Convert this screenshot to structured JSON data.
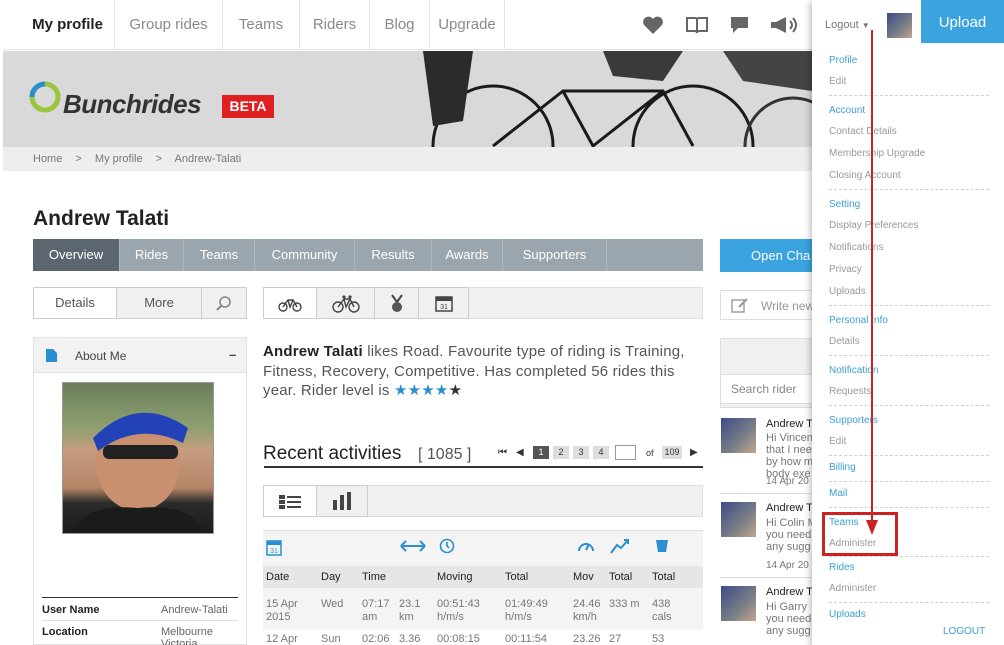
{
  "nav": {
    "items": [
      "My profile",
      "Group rides",
      "Teams",
      "Riders",
      "Blog",
      "Upgrade"
    ],
    "logout_label": "Logout",
    "upload_label": "Upload"
  },
  "banner": {
    "logo_text": "Bunchrides",
    "beta": "BETA"
  },
  "breadcrumb": [
    "Home",
    ">",
    "My profile",
    ">",
    "Andrew-Talati"
  ],
  "profile": {
    "name": "Andrew Talati",
    "tabs": [
      "Overview",
      "Rides",
      "Teams",
      "Community",
      "Results",
      "Awards",
      "Supporters"
    ],
    "details_label": "Details",
    "more_label": "More",
    "about_label": "About Me",
    "collapse_symbol": "–",
    "fields": [
      {
        "label": "User Name",
        "value": "Andrew-Talati"
      },
      {
        "label": "Location",
        "value": "Melbourne Victoria"
      }
    ],
    "bio_name": "Andrew Talati",
    "bio_text": " likes Road. Favourite type of riding is Training, Fitness, Recovery, Competitive. Has completed 56 rides this year. Rider level is",
    "rider_level_stars": 4,
    "rider_level_max": 5
  },
  "activities": {
    "title": "Recent activities",
    "count": "1085",
    "pages": [
      "1",
      "2",
      "3",
      "4"
    ],
    "page_of": "of",
    "total_pages": "109",
    "columns": [
      "Date",
      "Day",
      "Time",
      "",
      "Moving",
      "Total",
      "Mov",
      "Total",
      "Total"
    ],
    "rows": [
      [
        "15 Apr 2015",
        "Wed",
        "07:17 am",
        "23.1 km",
        "00:51:43 h/m/s",
        "01:49:49 h/m/s",
        "24.46 km/h",
        "333 m",
        "438 cals"
      ],
      [
        "12 Apr",
        "Sun",
        "02:06",
        "3.36",
        "00:08:15",
        "00:11:54",
        "23.26",
        "27",
        "53"
      ]
    ]
  },
  "chat": {
    "open_label": "Open Cha",
    "write_placeholder": "Write new",
    "search_placeholder": "Search rider",
    "messages": [
      {
        "name": "Andrew T",
        "lines": [
          "Hi Vincen",
          "that I nee",
          "by how m",
          "body exe"
        ],
        "date": "14 Apr 20"
      },
      {
        "name": "Andrew T",
        "lines": [
          "Hi Colin M",
          "you need",
          "any sugg"
        ],
        "date": "14 Apr 20"
      },
      {
        "name": "Andrew T",
        "lines": [
          "Hi Garry",
          "you need",
          "any sugg"
        ],
        "date": ""
      }
    ]
  },
  "menu": {
    "groups": [
      {
        "head": "Profile",
        "items": [
          "Edit"
        ]
      },
      {
        "head": "Account",
        "items": [
          "Contact Details",
          "Membership Upgrade",
          "Closing Account"
        ]
      },
      {
        "head": "Setting",
        "items": [
          "Display Preferences",
          "Notifications",
          "Privacy",
          "Uploads"
        ]
      },
      {
        "head": "Personal Info",
        "items": [
          "Details"
        ]
      },
      {
        "head": "Notification",
        "items": [
          "Requests"
        ]
      },
      {
        "head": "Supporters",
        "items": [
          "Edit"
        ]
      },
      {
        "head": "Billing",
        "items": []
      },
      {
        "head": "Mail",
        "items": []
      },
      {
        "head": "Teams",
        "items": [
          "Administer"
        ]
      },
      {
        "head": "Rides",
        "items": [
          "Administer"
        ]
      },
      {
        "head": "Uploads",
        "items": []
      }
    ],
    "logout": "LOGOUT",
    "highlight_color": "#cc2222"
  }
}
